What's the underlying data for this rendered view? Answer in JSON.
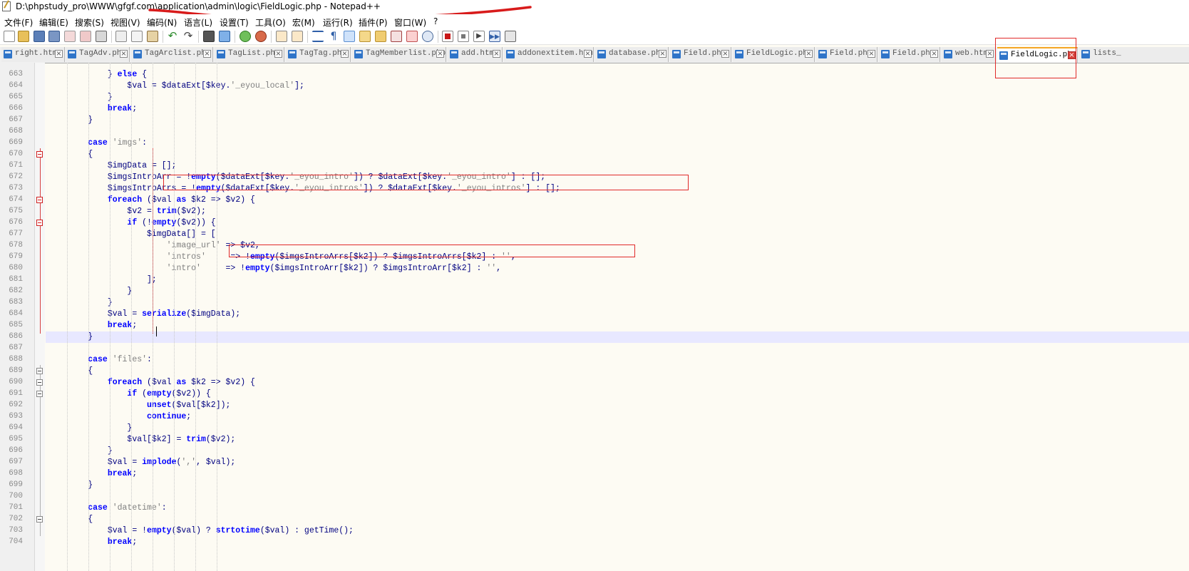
{
  "window": {
    "title": "D:\\phpstudy_pro\\WWW\\gfgf.com\\application\\admin\\logic\\FieldLogic.php - Notepad++"
  },
  "menu": [
    "文件(F)",
    "编辑(E)",
    "搜索(S)",
    "视图(V)",
    "编码(N)",
    "语言(L)",
    "设置(T)",
    "工具(O)",
    "宏(M)",
    "运行(R)",
    "插件(P)",
    "窗口(W)",
    "?"
  ],
  "toolbar": {
    "buttons": [
      "new-file-icon",
      "open-file-icon",
      "save-icon",
      "save-all-icon",
      "close-icon",
      "close-all-icon",
      "print-icon",
      "cut-icon",
      "copy-icon",
      "paste-icon",
      "undo-icon",
      "redo-icon",
      "find-icon",
      "replace-icon",
      "zoom-in-icon",
      "zoom-out-icon",
      "sync-vertical-icon",
      "sync-horizontal-icon",
      "word-wrap-icon",
      "show-all-chars-icon",
      "indent-guide-icon",
      "user-language-icon",
      "doc-map-icon",
      "function-list-icon",
      "folder-workspace-icon",
      "monitoring-icon",
      "record-macro-icon",
      "stop-record-icon",
      "play-macro-icon",
      "run-macro-multiple-icon",
      "save-macro-icon"
    ]
  },
  "tabs": [
    "right.htm",
    "TagAdv.php",
    "TagArclist.php",
    "TagList.php",
    "TagTag.php",
    "TagMemberlist.php",
    "add.htm",
    "addonextitem.htm",
    "database.php",
    "Field.php",
    "FieldLogic.php",
    "Field.php",
    "Field.php",
    "web.htm",
    "FieldLogic.php",
    "lists_"
  ],
  "active_tab_index": 14,
  "code": [
    {
      "n": "663",
      "text": "            } else {"
    },
    {
      "n": "664",
      "text": "                $val = $dataExt[$key.'_eyou_local'];"
    },
    {
      "n": "665",
      "text": "            }"
    },
    {
      "n": "666",
      "text": "            break;"
    },
    {
      "n": "667",
      "text": "        }"
    },
    {
      "n": "668",
      "text": ""
    },
    {
      "n": "669",
      "text": "        case 'imgs':"
    },
    {
      "n": "670",
      "text": "        {"
    },
    {
      "n": "671",
      "text": "            $imgData = [];"
    },
    {
      "n": "672",
      "text": "            $imgsIntroArr = !empty($dataExt[$key.'_eyou_intro']) ? $dataExt[$key.'_eyou_intro'] : [];"
    },
    {
      "n": "673",
      "text": "            $imgsIntroArrs = !empty($dataExt[$key.'_eyou_intros']) ? $dataExt[$key.'_eyou_intros'] : [];"
    },
    {
      "n": "674",
      "text": "            foreach ($val as $k2 => $v2) {"
    },
    {
      "n": "675",
      "text": "                $v2 = trim($v2);"
    },
    {
      "n": "676",
      "text": "                if (!empty($v2)) {"
    },
    {
      "n": "677",
      "text": "                    $imgData[] = ["
    },
    {
      "n": "678",
      "text": "                        'image_url' => $v2,"
    },
    {
      "n": "679",
      "text": "                        'intros'     => !empty($imgsIntroArrs[$k2]) ? $imgsIntroArrs[$k2] : '',"
    },
    {
      "n": "680",
      "text": "                        'intro'     => !empty($imgsIntroArr[$k2]) ? $imgsIntroArr[$k2] : '',"
    },
    {
      "n": "681",
      "text": "                    ];"
    },
    {
      "n": "682",
      "text": "                }"
    },
    {
      "n": "683",
      "text": "            }"
    },
    {
      "n": "684",
      "text": "            $val = serialize($imgData);"
    },
    {
      "n": "685",
      "text": "            break;"
    },
    {
      "n": "686",
      "text": "        }"
    },
    {
      "n": "687",
      "text": ""
    },
    {
      "n": "688",
      "text": "        case 'files':"
    },
    {
      "n": "689",
      "text": "        {"
    },
    {
      "n": "690",
      "text": "            foreach ($val as $k2 => $v2) {"
    },
    {
      "n": "691",
      "text": "                if (empty($v2)) {"
    },
    {
      "n": "692",
      "text": "                    unset($val[$k2]);"
    },
    {
      "n": "693",
      "text": "                    continue;"
    },
    {
      "n": "694",
      "text": "                }"
    },
    {
      "n": "695",
      "text": "                $val[$k2] = trim($v2);"
    },
    {
      "n": "696",
      "text": "            }"
    },
    {
      "n": "697",
      "text": "            $val = implode(',', $val);"
    },
    {
      "n": "698",
      "text": "            break;"
    },
    {
      "n": "699",
      "text": "        }"
    },
    {
      "n": "700",
      "text": ""
    },
    {
      "n": "701",
      "text": "        case 'datetime':"
    },
    {
      "n": "702",
      "text": "        {"
    },
    {
      "n": "703",
      "text": "            $val = !empty($val) ? strtotime($val) : getTime();"
    },
    {
      "n": "704",
      "text": "            break;"
    }
  ],
  "current_line": "686",
  "colors": {
    "keyword": "#0000ff",
    "variable": "#000080",
    "string": "#808080",
    "function": "#000080",
    "annotation": "#e02a2a",
    "active_tab_accent": "#f5a623"
  }
}
